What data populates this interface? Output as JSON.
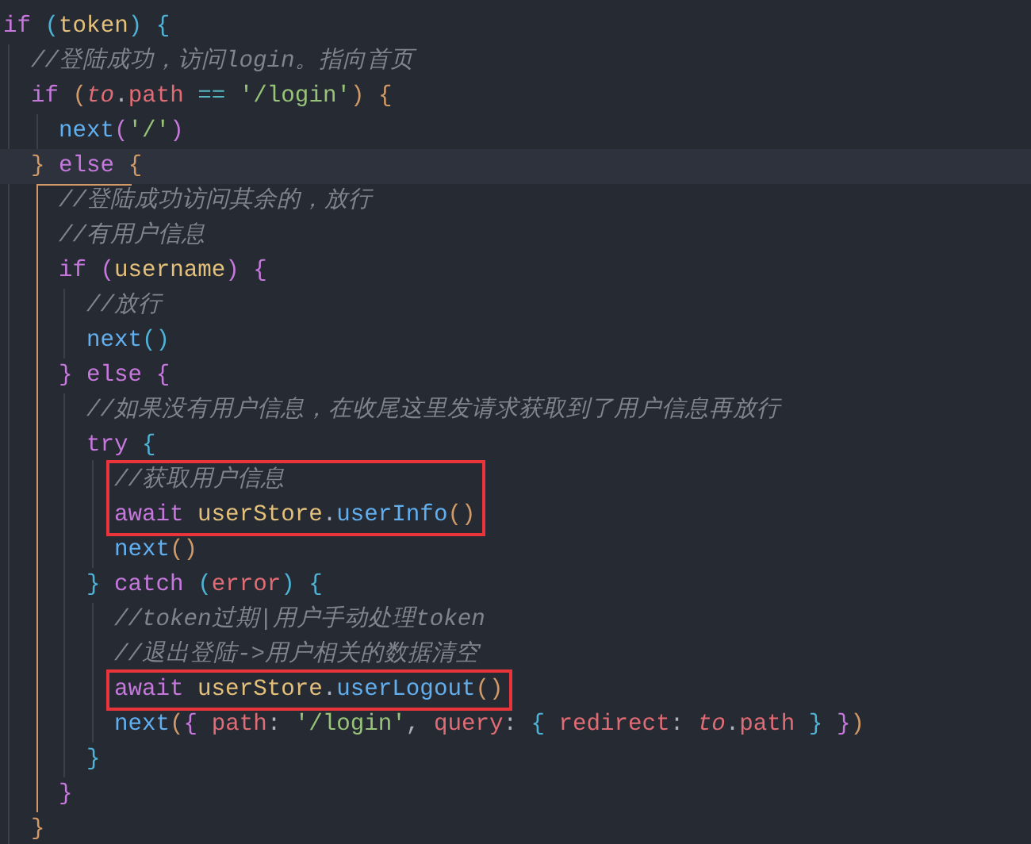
{
  "code": [
    {
      "kind": "line",
      "tokens": [
        {
          "kind": "kw",
          "text": "if "
        },
        {
          "kind": "b1",
          "text": "("
        },
        {
          "kind": "var",
          "text": "token"
        },
        {
          "kind": "b1",
          "text": ") "
        },
        {
          "kind": "b1",
          "text": "{"
        }
      ],
      "children": [
        {
          "kind": "line",
          "tokens": [
            {
              "kind": "comment",
              "text": "//登陆成功，访问login。指向首页"
            }
          ]
        },
        {
          "kind": "line",
          "tokens": [
            {
              "kind": "kw",
              "text": "if "
            },
            {
              "kind": "b2",
              "text": "("
            },
            {
              "kind": "param",
              "text": "to"
            },
            {
              "kind": "plain",
              "text": "."
            },
            {
              "kind": "prop",
              "text": "path "
            },
            {
              "kind": "op",
              "text": "== "
            },
            {
              "kind": "str",
              "text": "'/login'"
            },
            {
              "kind": "b2",
              "text": ") "
            },
            {
              "kind": "b2",
              "text": "{"
            }
          ],
          "children": [
            {
              "kind": "line",
              "tokens": [
                {
                  "kind": "fn",
                  "text": "next"
                },
                {
                  "kind": "b3",
                  "text": "("
                },
                {
                  "kind": "str",
                  "text": "'/'"
                },
                {
                  "kind": "b3",
                  "text": ")"
                }
              ]
            }
          ]
        },
        {
          "kind": "line",
          "current": true,
          "active_guide": true,
          "tokens": [
            {
              "kind": "b2",
              "text": "} "
            },
            {
              "kind": "kw",
              "text": "else "
            },
            {
              "kind": "b2",
              "text": "{"
            }
          ],
          "children": [
            {
              "kind": "line",
              "tokens": [
                {
                  "kind": "comment",
                  "text": "//登陆成功访问其余的，放行"
                }
              ]
            },
            {
              "kind": "line",
              "tokens": [
                {
                  "kind": "comment",
                  "text": "//有用户信息"
                }
              ]
            },
            {
              "kind": "line",
              "tokens": [
                {
                  "kind": "kw",
                  "text": "if "
                },
                {
                  "kind": "b3",
                  "text": "("
                },
                {
                  "kind": "var",
                  "text": "username"
                },
                {
                  "kind": "b3",
                  "text": ") "
                },
                {
                  "kind": "b3",
                  "text": "{"
                }
              ],
              "children": [
                {
                  "kind": "line",
                  "tokens": [
                    {
                      "kind": "comment",
                      "text": "//放行"
                    }
                  ]
                },
                {
                  "kind": "line",
                  "tokens": [
                    {
                      "kind": "fn",
                      "text": "next"
                    },
                    {
                      "kind": "b1",
                      "text": "()"
                    }
                  ]
                }
              ]
            },
            {
              "kind": "line",
              "tokens": [
                {
                  "kind": "b3",
                  "text": "} "
                },
                {
                  "kind": "kw",
                  "text": "else "
                },
                {
                  "kind": "b3",
                  "text": "{"
                }
              ],
              "children": [
                {
                  "kind": "line",
                  "tokens": [
                    {
                      "kind": "comment",
                      "text": "//如果没有用户信息，在收尾这里发请求获取到了用户信息再放行"
                    }
                  ]
                },
                {
                  "kind": "line",
                  "tokens": [
                    {
                      "kind": "kw",
                      "text": "try "
                    },
                    {
                      "kind": "b1",
                      "text": "{"
                    }
                  ],
                  "children": [
                    {
                      "kind": "highlight",
                      "children": [
                        {
                          "kind": "line",
                          "tokens": [
                            {
                              "kind": "comment",
                              "text": "//获取用户信息"
                            }
                          ]
                        },
                        {
                          "kind": "line",
                          "tokens": [
                            {
                              "kind": "kw",
                              "text": "await "
                            },
                            {
                              "kind": "var",
                              "text": "userStore"
                            },
                            {
                              "kind": "plain",
                              "text": "."
                            },
                            {
                              "kind": "fn",
                              "text": "userInfo"
                            },
                            {
                              "kind": "b2",
                              "text": "()"
                            }
                          ]
                        }
                      ]
                    },
                    {
                      "kind": "line",
                      "tokens": [
                        {
                          "kind": "fn",
                          "text": "next"
                        },
                        {
                          "kind": "b2",
                          "text": "()"
                        }
                      ]
                    }
                  ]
                },
                {
                  "kind": "line",
                  "tokens": [
                    {
                      "kind": "b1",
                      "text": "} "
                    },
                    {
                      "kind": "kw",
                      "text": "catch "
                    },
                    {
                      "kind": "b1",
                      "text": "("
                    },
                    {
                      "kind": "prop",
                      "text": "error"
                    },
                    {
                      "kind": "b1",
                      "text": ") "
                    },
                    {
                      "kind": "b1",
                      "text": "{"
                    }
                  ],
                  "children": [
                    {
                      "kind": "line",
                      "tokens": [
                        {
                          "kind": "comment",
                          "text": "//token过期|用户手动处理token"
                        }
                      ]
                    },
                    {
                      "kind": "line",
                      "tokens": [
                        {
                          "kind": "comment",
                          "text": "//退出登陆->用户相关的数据清空"
                        }
                      ]
                    },
                    {
                      "kind": "highlight",
                      "children": [
                        {
                          "kind": "line",
                          "tokens": [
                            {
                              "kind": "kw",
                              "text": "await "
                            },
                            {
                              "kind": "var",
                              "text": "userStore"
                            },
                            {
                              "kind": "plain",
                              "text": "."
                            },
                            {
                              "kind": "fn",
                              "text": "userLogout"
                            },
                            {
                              "kind": "b2",
                              "text": "()"
                            }
                          ]
                        }
                      ]
                    },
                    {
                      "kind": "line",
                      "tokens": [
                        {
                          "kind": "fn",
                          "text": "next"
                        },
                        {
                          "kind": "b2",
                          "text": "("
                        },
                        {
                          "kind": "b3",
                          "text": "{ "
                        },
                        {
                          "kind": "prop",
                          "text": "path"
                        },
                        {
                          "kind": "plain",
                          "text": ": "
                        },
                        {
                          "kind": "str",
                          "text": "'/login'"
                        },
                        {
                          "kind": "plain",
                          "text": ", "
                        },
                        {
                          "kind": "prop",
                          "text": "query"
                        },
                        {
                          "kind": "plain",
                          "text": ": "
                        },
                        {
                          "kind": "b1",
                          "text": "{ "
                        },
                        {
                          "kind": "prop",
                          "text": "redirect"
                        },
                        {
                          "kind": "plain",
                          "text": ": "
                        },
                        {
                          "kind": "param",
                          "text": "to"
                        },
                        {
                          "kind": "plain",
                          "text": "."
                        },
                        {
                          "kind": "prop",
                          "text": "path "
                        },
                        {
                          "kind": "b1",
                          "text": "} "
                        },
                        {
                          "kind": "b3",
                          "text": "}"
                        },
                        {
                          "kind": "b2",
                          "text": ")"
                        }
                      ]
                    }
                  ]
                },
                {
                  "kind": "line",
                  "tokens": [
                    {
                      "kind": "b1",
                      "text": "}"
                    }
                  ]
                }
              ]
            },
            {
              "kind": "line",
              "tokens": [
                {
                  "kind": "b3",
                  "text": "}"
                }
              ]
            }
          ]
        },
        {
          "kind": "line",
          "tokens": [
            {
              "kind": "b2",
              "text": "}"
            }
          ]
        }
      ]
    }
  ]
}
